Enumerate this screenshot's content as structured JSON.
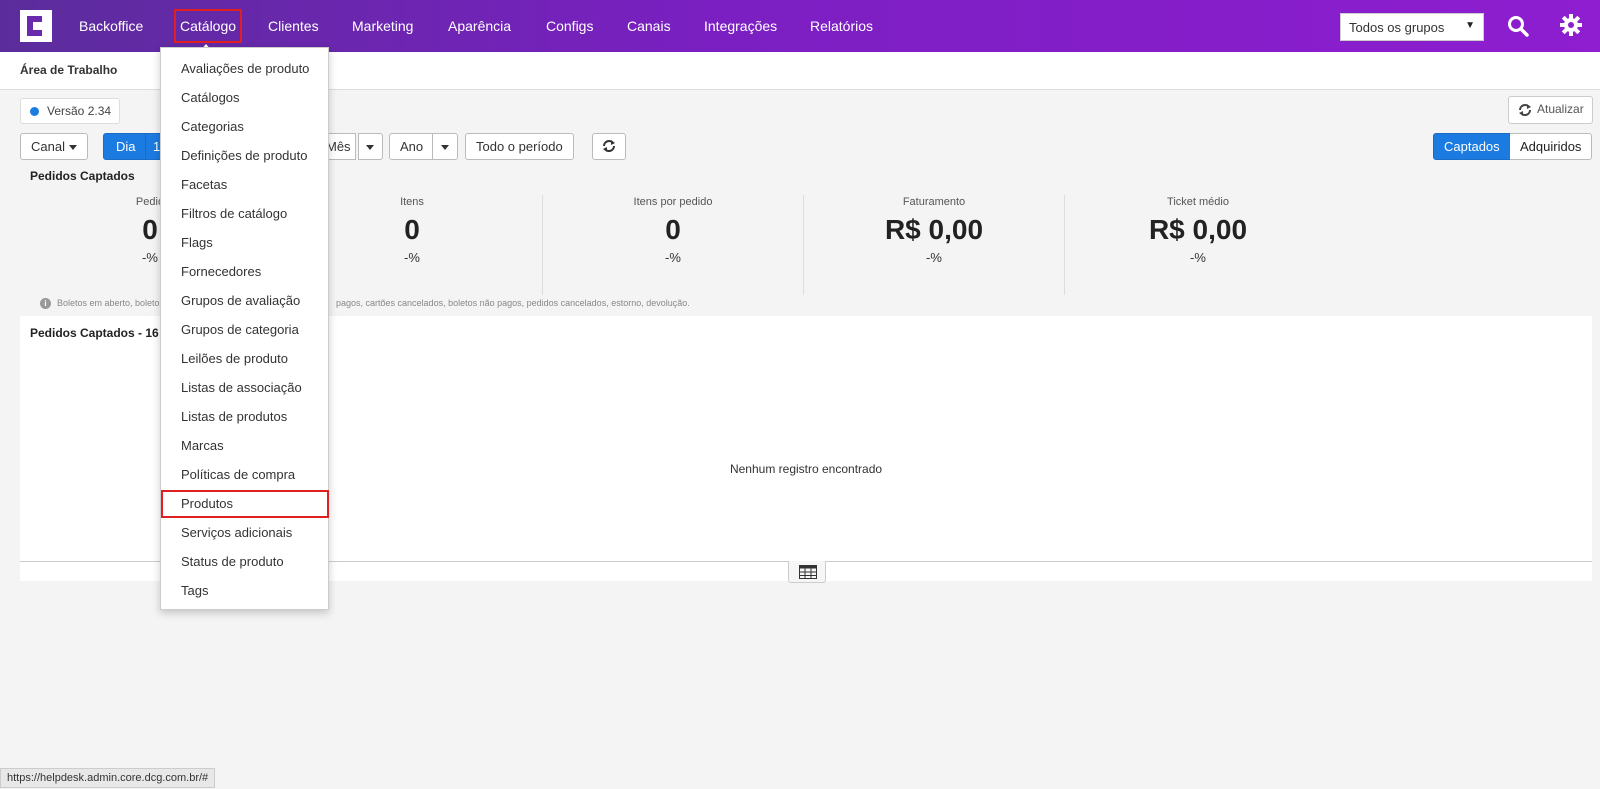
{
  "nav": {
    "items": [
      "Backoffice",
      "Catálogo",
      "Clientes",
      "Marketing",
      "Aparência",
      "Configs",
      "Canais",
      "Integrações",
      "Relatórios"
    ],
    "group_select": "Todos os grupos"
  },
  "header": {
    "title": "Área de Trabalho"
  },
  "version": "Versão 2.34",
  "refresh_label": "Atualizar",
  "filters": {
    "channel": "Canal",
    "day": "Dia",
    "day_partial": "1",
    "month": "Mês",
    "year": "Ano",
    "all_period": "Todo o período",
    "captured": "Captados",
    "acquired": "Adquiridos"
  },
  "section_title": "Pedidos Captados",
  "stats": [
    {
      "label": "Pedid",
      "value": "0",
      "pct": "-%"
    },
    {
      "label": "Itens",
      "value": "0",
      "pct": "-%"
    },
    {
      "label": "Itens por pedido",
      "value": "0",
      "pct": "-%"
    },
    {
      "label": "Faturamento",
      "value": "R$ 0,00",
      "pct": "-%"
    },
    {
      "label": "Ticket médio",
      "value": "R$ 0,00",
      "pct": "-%"
    }
  ],
  "info_note_left": "Boletos em aberto, boleto",
  "info_note_right": "pagos, cartões cancelados, boletos não pagos, pedidos cancelados, estorno, devolução.",
  "panel": {
    "title": "Pedidos Captados - 16",
    "empty": "Nenhum registro encontrado"
  },
  "dropdown": {
    "items": [
      "Avaliações de produto",
      "Catálogos",
      "Categorias",
      "Definições de produto",
      "Facetas",
      "Filtros de catálogo",
      "Flags",
      "Fornecedores",
      "Grupos de avaliação",
      "Grupos de categoria",
      "Leilões de produto",
      "Listas de associação",
      "Listas de produtos",
      "Marcas",
      "Políticas de compra",
      "Produtos",
      "Serviços adicionais",
      "Status de produto",
      "Tags"
    ]
  },
  "status_url": "https://helpdesk.admin.core.dcg.com.br/#",
  "colors": {
    "nav_start": "#5b2d9c",
    "nav_end": "#8e1ed0",
    "primary": "#1b7be0",
    "highlight": "#e02020"
  }
}
